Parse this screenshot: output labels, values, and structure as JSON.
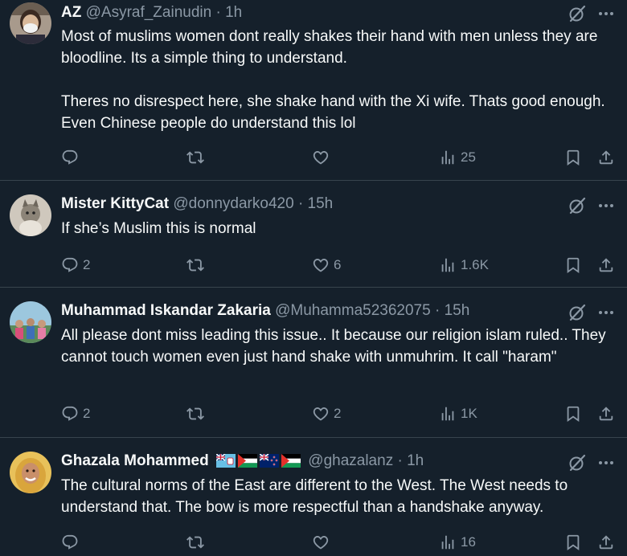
{
  "tweets": [
    {
      "name": "AZ",
      "handle": "@Asyraf_Zainudin",
      "separator": "·",
      "time": "1h",
      "text": [
        "Most of muslims women dont really shakes their hand with men unless they are bloodline. Its a simple thing to understand.",
        "Theres no disrespect here, she shake hand with the Xi wife. Thats good enough. Even Chinese people do understand this lol"
      ],
      "replies": "",
      "reposts": "",
      "likes": "",
      "views": "25"
    },
    {
      "name": "Mister KittyCat",
      "handle": "@donnydarko420",
      "separator": "·",
      "time": "15h",
      "text": [
        "If she’s Muslim this is normal"
      ],
      "replies": "2",
      "reposts": "",
      "likes": "6",
      "views": "1.6K"
    },
    {
      "name": "Muhammad Iskandar Zakaria",
      "handle": "@Muhamma52362075",
      "separator": "·",
      "time": "15h",
      "text": [
        "All please dont miss leading this issue.. It because our religion islam ruled.. They cannot touch women even just hand shake with unmuhrim. It call \"haram\""
      ],
      "replies": "2",
      "reposts": "",
      "likes": "2",
      "views": "1K"
    },
    {
      "name": "Ghazala Mohammed",
      "flags": [
        "fiji-flag",
        "palestine-flag",
        "new-zealand-flag",
        "palestine-flag"
      ],
      "handle": "@ghazalanz",
      "separator": "·",
      "time": "1h",
      "text": [
        "The cultural norms of the East are different to the West. The West needs to understand that. The bow is more respectful than a handshake anyway."
      ],
      "replies": "",
      "reposts": "",
      "likes": "",
      "views": "16"
    }
  ],
  "colors": {
    "background": "#15202b",
    "text": "#f7f9f9",
    "secondary": "#8b98a5",
    "divider": "#38444d"
  }
}
